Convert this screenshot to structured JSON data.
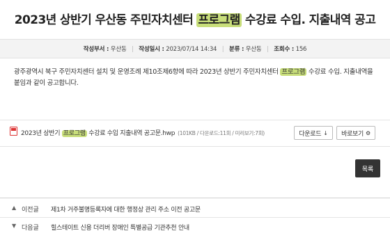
{
  "post": {
    "title_pre": "2023년 상반기 우산동 주민자치센터 ",
    "title_hl": "프로그램",
    "title_post": " 수강료 수입. 지출내역 공고"
  },
  "meta": {
    "author_label": "작성부서 :",
    "author": "우산동",
    "date_label": "작성일시 :",
    "date": "2023/07/14 14:34",
    "category_label": "분류 :",
    "category": "우산동",
    "views_label": "조회수 :",
    "views": "156"
  },
  "body": {
    "line1_pre": "광주광역시 북구 주민자치센터 설치 및 운영조례 제10조제6항에 따라 2023년 상반기 주민자치센터 ",
    "line1_hl": "프로그램",
    "line1_post": " 수강료 수입. 지출내역을",
    "line2": "붙임과 같이 공고합니다."
  },
  "attachment": {
    "name_pre": "2023년 상반기 ",
    "name_hl": "프로그램",
    "name_post": " 수강료 수입 지출내역 공고문.hwp",
    "info": "(101KB / 다운로드:11회 / 미리보기:7회)",
    "download_label": "다운로드",
    "preview_label": "바로보기",
    "download_icon": "arrow-down-icon",
    "preview_icon": "gear-icon"
  },
  "list_button": "목록",
  "nav": {
    "prev_label": "이전글",
    "prev_title": "제1차 거주불명등록자에 대한 행정상 관리 주소 이전 공고문",
    "next_label": "다음글",
    "next_title": "힐스테이트 신용 더리버 장애인 특별공급 기관추천 안내"
  },
  "colors": {
    "highlight": "#c8de7a",
    "list_button_bg": "#333333",
    "file_icon": "#dd3333"
  }
}
